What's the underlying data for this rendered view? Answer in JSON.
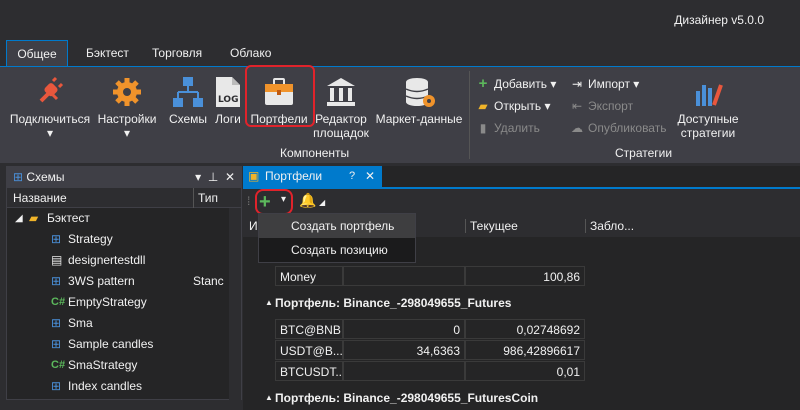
{
  "app": {
    "title": "Дизайнер v5.0.0"
  },
  "tabs": [
    "Общее",
    "Бэктест",
    "Торговля",
    "Облако"
  ],
  "ribbon": {
    "connect": "Подключиться",
    "settings": "Настройки",
    "schemas": "Схемы",
    "logs": "Логи",
    "portfolios": "Портфели",
    "exchange_editor": "Редактор площадок",
    "market_data": "Маркет-данные",
    "components_label": "Компоненты",
    "add": "Добавить",
    "open": "Открыть",
    "delete": "Удалить",
    "import": "Импорт",
    "export": "Экспорт",
    "publish": "Опубликовать",
    "available_strategies": "Доступные стратегии",
    "strategies_label": "Стратегии"
  },
  "schemas_panel": {
    "title": "Схемы",
    "columns": {
      "name": "Название",
      "type": "Тип"
    },
    "folder": "Бэктест",
    "items": [
      {
        "name": "Strategy",
        "type": ""
      },
      {
        "name": "designertestdll",
        "type": ""
      },
      {
        "name": "3WS pattern",
        "type": "Stanc"
      },
      {
        "name": "EmptyStrategy",
        "type": ""
      },
      {
        "name": "Sma",
        "type": ""
      },
      {
        "name": "Sample candles",
        "type": ""
      },
      {
        "name": "SmaStrategy",
        "type": ""
      },
      {
        "name": "Index candles",
        "type": ""
      }
    ]
  },
  "portfolios_panel": {
    "tab": "Портфели",
    "columns": {
      "first": "И",
      "current": "Текущее",
      "blocked": "Забло..."
    },
    "dropdown": [
      "Создать портфель",
      "Создать позицию"
    ],
    "rows_top": [
      {
        "name": "Money",
        "begin": "",
        "current": "100,86"
      }
    ],
    "group1": "Портфель: Binance_-298049655_Futures",
    "group1_rows": [
      {
        "name": "BTC@BNB",
        "begin": "0",
        "current": "0,02748692"
      },
      {
        "name": "USDT@B...",
        "begin": "34,6363",
        "current": "986,42896617"
      },
      {
        "name": "BTCUSDT...",
        "begin": "",
        "current": "0,01"
      }
    ],
    "group2": "Портфель: Binance_-298049655_FuturesCoin"
  }
}
